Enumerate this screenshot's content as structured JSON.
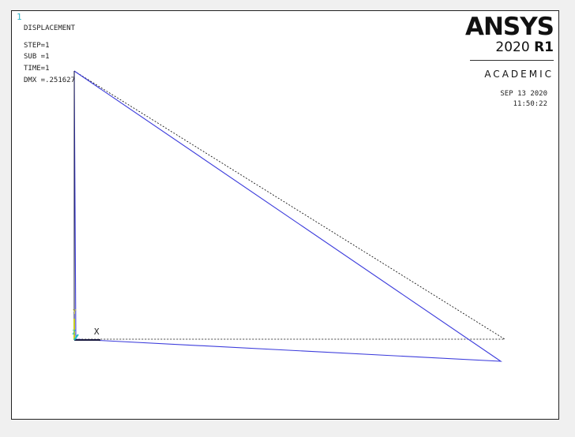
{
  "window_number": "1",
  "plot": {
    "title": "DISPLACEMENT",
    "step": "STEP=1",
    "sub": "SUB =1",
    "time": "TIME=1",
    "dmx": "DMX =.251627"
  },
  "logo": {
    "brand": "ANSYS",
    "version_year": "2020",
    "version_release": "R1",
    "edition": "ACADEMIC"
  },
  "timestamp": {
    "date": "SEP 13 2020",
    "time": "11:50:22"
  },
  "triad": {
    "x_label": "X",
    "y_label": "Y",
    "z_label": "Z"
  },
  "colors": {
    "deformed_shape": "#3c3cdc",
    "undeformed_shape": "#000000",
    "triad_y": "#c8d020",
    "triad_z": "#20c0c0"
  }
}
